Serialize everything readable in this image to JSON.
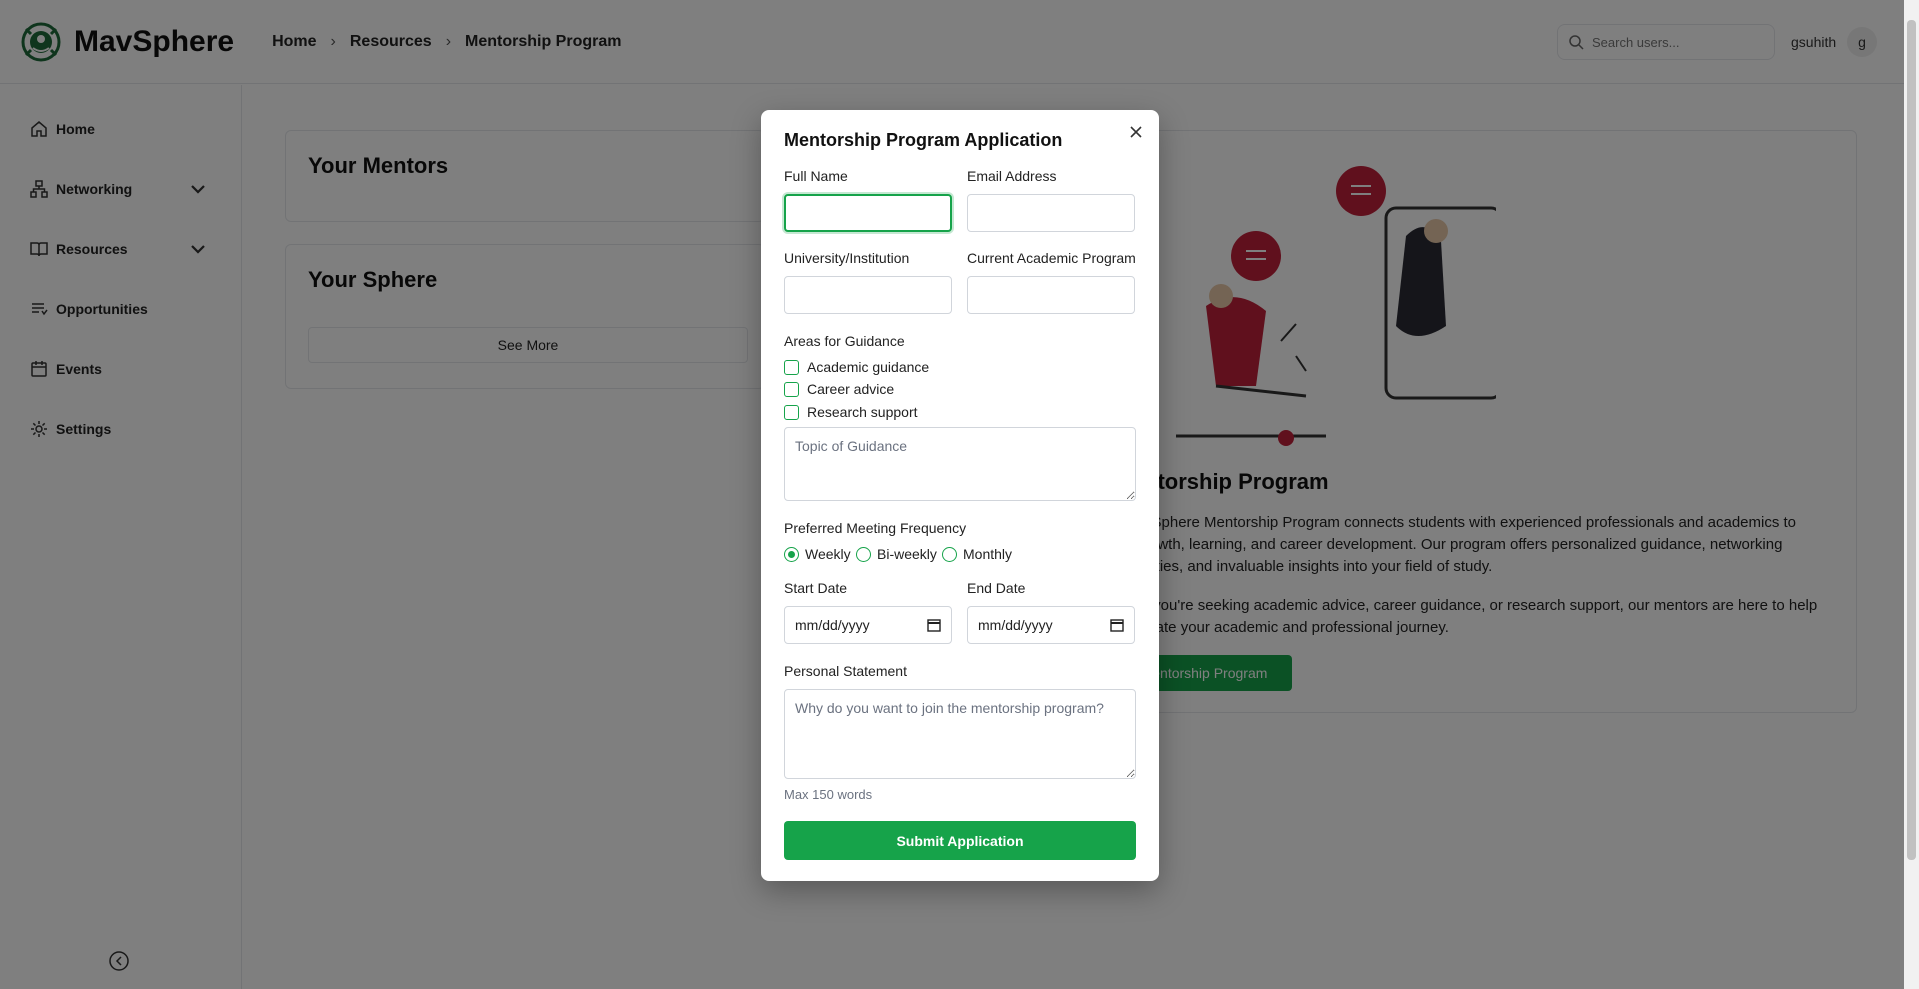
{
  "app": {
    "name": "MavSphere"
  },
  "breadcrumb": [
    "Home",
    "Resources",
    "Mentorship Program"
  ],
  "search": {
    "placeholder": "Search users..."
  },
  "user": {
    "name": "gsuhith",
    "initial": "g"
  },
  "sidebar": {
    "items": [
      {
        "label": "Home",
        "icon": "home-icon"
      },
      {
        "label": "Networking",
        "icon": "network-icon",
        "expandable": true
      },
      {
        "label": "Resources",
        "icon": "book-icon",
        "expandable": true
      },
      {
        "label": "Opportunities",
        "icon": "list-icon"
      },
      {
        "label": "Events",
        "icon": "calendar-icon"
      },
      {
        "label": "Settings",
        "icon": "gear-icon"
      }
    ]
  },
  "main": {
    "mentors_title": "Your Mentors",
    "sphere_title": "Your Sphere",
    "see_more": "See More",
    "program": {
      "title": "ntorship Program",
      "para1_lines": [
        "vSphere Mentorship Program connects students with experienced professionals and academics to",
        "rowth, learning, and career development. Our program offers personalized guidance, networking",
        "nities, and invaluable insights into your field of study."
      ],
      "para2_lines": [
        "r you're seeking academic advice, career guidance, or research support, our mentors are here to help",
        "igate your academic and professional journey."
      ],
      "button": "Mentorship Program"
    }
  },
  "modal": {
    "title": "Mentorship Program Application",
    "full_name_label": "Full Name",
    "full_name_value": "",
    "email_label": "Email Address",
    "email_value": "",
    "university_label": "University/Institution",
    "university_value": "",
    "program_label": "Current Academic Program",
    "program_value": "",
    "areas_label": "Areas for Guidance",
    "areas": [
      "Academic guidance",
      "Career advice",
      "Research support"
    ],
    "topic_placeholder": "Topic of Guidance",
    "frequency_label": "Preferred Meeting Frequency",
    "frequency_options": [
      "Weekly",
      "Bi-weekly",
      "Monthly"
    ],
    "frequency_selected": "Weekly",
    "start_date_label": "Start Date",
    "end_date_label": "End Date",
    "date_placeholder": "mm/dd/yyyy",
    "statement_label": "Personal Statement",
    "statement_placeholder": "Why do you want to join the mentorship program?",
    "statement_hint": "Max 150 words",
    "submit_label": "Submit Application"
  },
  "colors": {
    "accent": "#16a34a",
    "overlay": "rgba(0,0,0,0.5)"
  }
}
